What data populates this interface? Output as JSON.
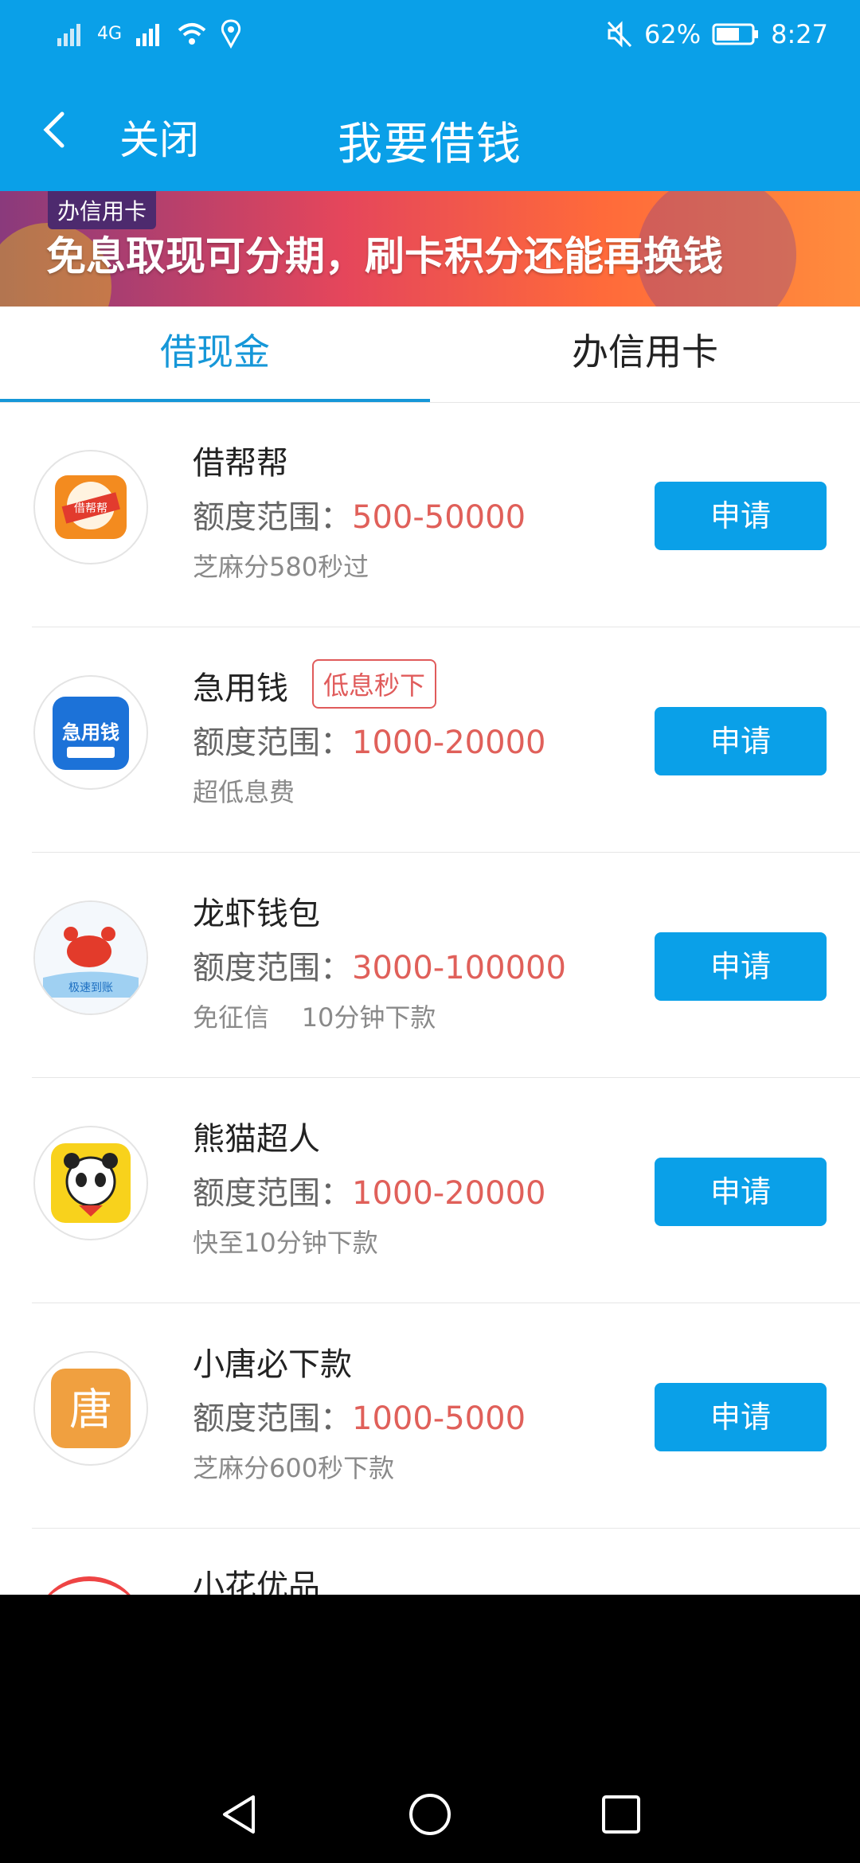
{
  "status": {
    "battery": "62%",
    "time": "8:27",
    "network": "4G"
  },
  "nav": {
    "close_label": "关闭",
    "title": "我要借钱"
  },
  "banner": {
    "badge": "办信用卡",
    "text": "免息取现可分期，刷卡积分还能再换钱"
  },
  "tabs": [
    {
      "label": "借现金",
      "active": true
    },
    {
      "label": "办信用卡",
      "active": false
    }
  ],
  "range_label": "额度范围：",
  "apply_label": "申请",
  "items": [
    {
      "name": "借帮帮",
      "tag": "",
      "range": "500-50000",
      "desc": "芝麻分580秒过",
      "logo_text": "借帮帮"
    },
    {
      "name": "急用钱",
      "tag": "低息秒下",
      "range": "1000-20000",
      "desc": "超低息费",
      "logo_text": "急用钱"
    },
    {
      "name": "龙虾钱包",
      "tag": "",
      "range": "3000-100000",
      "desc": "免征信    10分钟下款",
      "logo_text": "极速到账"
    },
    {
      "name": "熊猫超人",
      "tag": "",
      "range": "1000-20000",
      "desc": "快至10分钟下款",
      "logo_text": ""
    },
    {
      "name": "小唐必下款",
      "tag": "",
      "range": "1000-5000",
      "desc": "芝麻分600秒下款",
      "logo_text": "唐"
    }
  ],
  "partial_item": {
    "name": "小花优品"
  }
}
